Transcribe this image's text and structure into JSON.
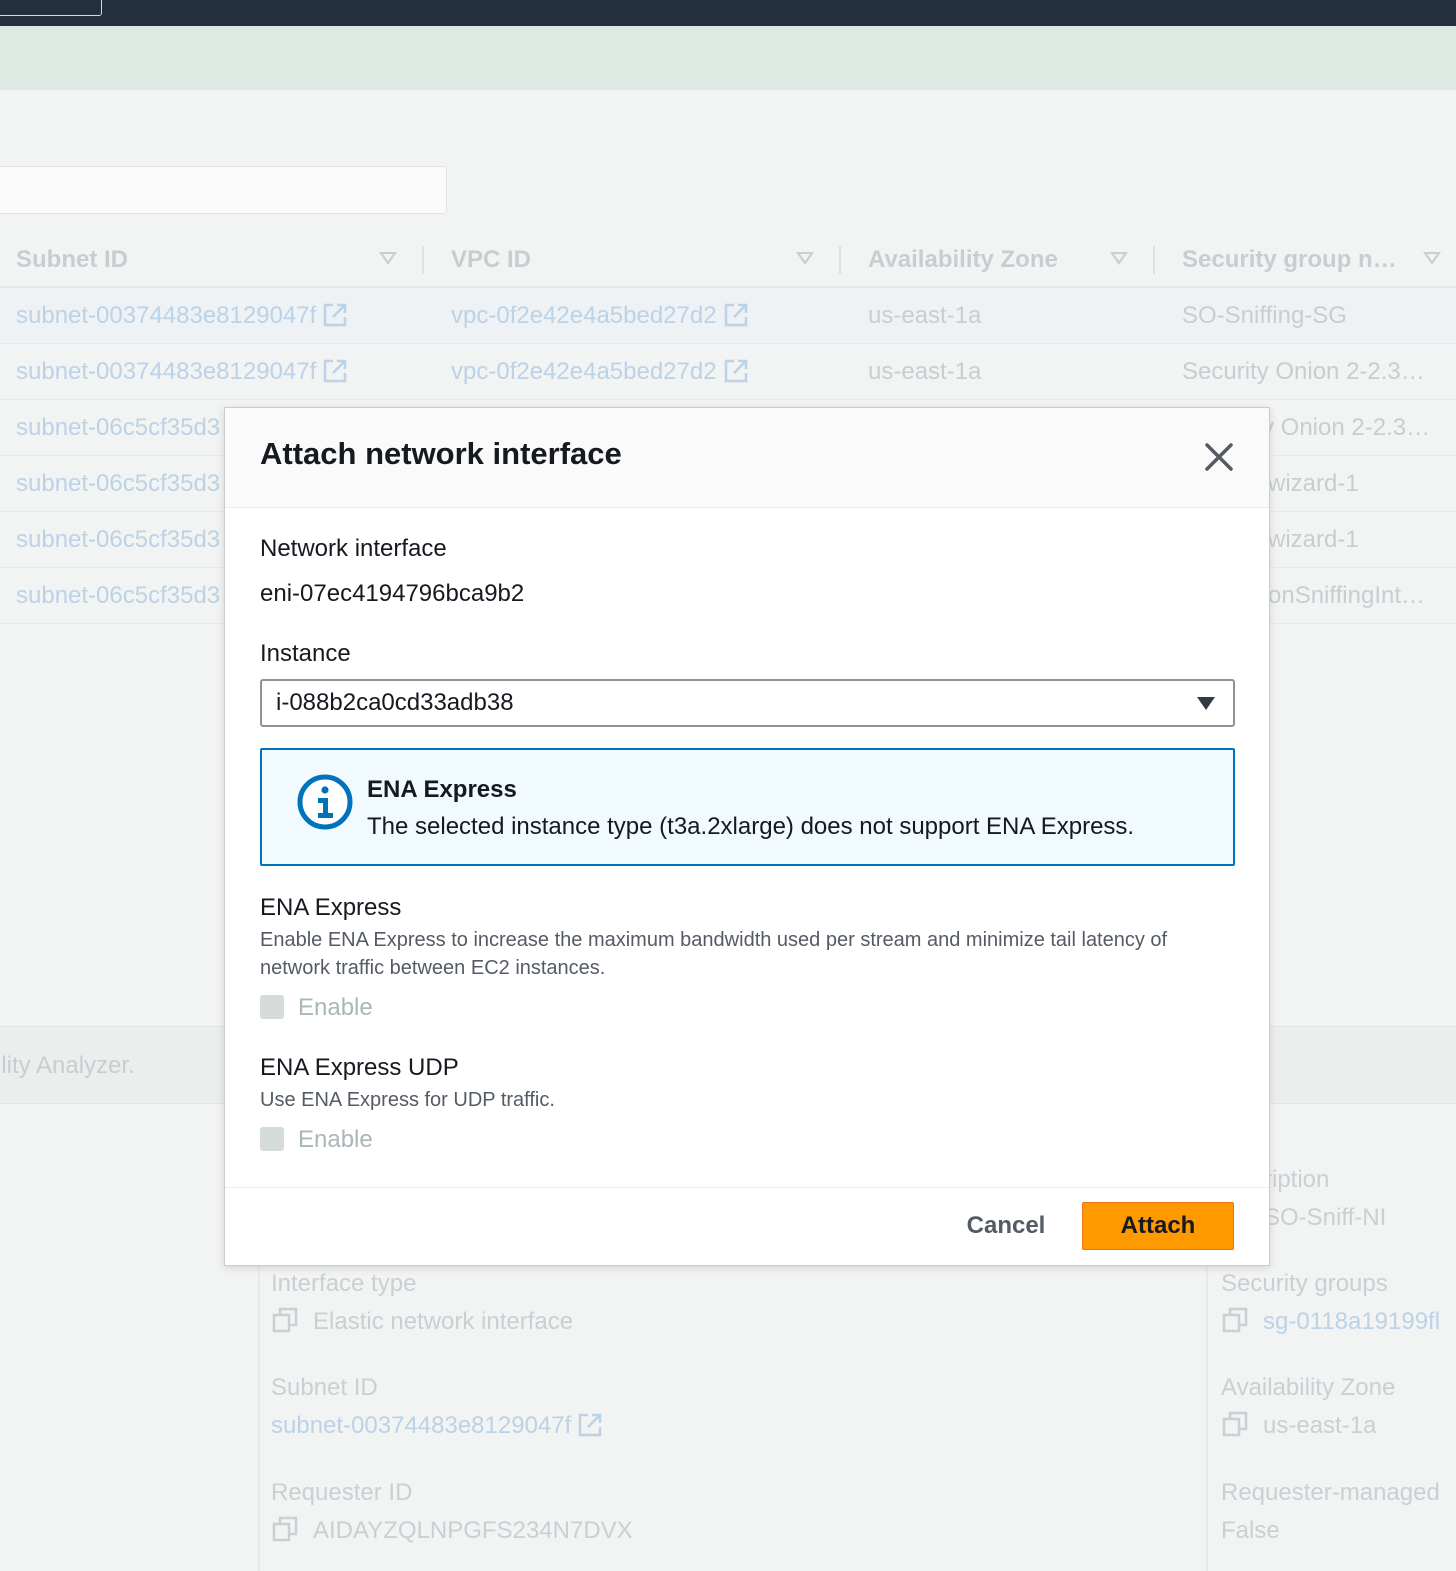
{
  "background": {
    "table": {
      "headers": [
        "Subnet ID",
        "VPC ID",
        "Availability Zone",
        "Security group n…"
      ],
      "rows": [
        {
          "subnet": "subnet-00374483e8129047f",
          "vpc": "vpc-0f2e42e4a5bed27d2",
          "az": "us-east-1a",
          "sg": "SO-Sniffing-SG"
        },
        {
          "subnet": "subnet-00374483e8129047f",
          "vpc": "vpc-0f2e42e4a5bed27d2",
          "az": "us-east-1a",
          "sg": "Security Onion 2-2.3…"
        },
        {
          "subnet": "subnet-06c5cf35d3",
          "sg": "y Onion 2-2.3…"
        },
        {
          "subnet": "subnet-06c5cf35d3",
          "sg": "wizard-1"
        },
        {
          "subnet": "subnet-06c5cf35d3",
          "sg": "wizard-1"
        },
        {
          "subnet": "subnet-06c5cf35d3",
          "sg": "onSniffingInt…"
        }
      ]
    },
    "band_text": "ility Analyzer.",
    "details": {
      "interface_type_label": "Interface type",
      "interface_type_value": "Elastic network interface",
      "subnet_id_label": "Subnet ID",
      "subnet_id_value": "subnet-00374483e8129047f",
      "requester_id_label": "Requester ID",
      "requester_id_value": "AIDAYZQLNPGFS234N7DVX",
      "description_label": "ription",
      "description_value": "SO-Sniff-NI",
      "security_groups_label": "Security groups",
      "security_groups_value": "sg-0118a19199fl",
      "az_label": "Availability Zone",
      "az_value": "us-east-1a",
      "requester_managed_label": "Requester-managed",
      "requester_managed_value": "False"
    }
  },
  "modal": {
    "title": "Attach network interface",
    "network_interface_label": "Network interface",
    "network_interface_value": "eni-07ec4194796bca9b2",
    "instance_label": "Instance",
    "instance_value": "i-088b2ca0cd33adb38",
    "alert": {
      "title": "ENA Express",
      "text": "The selected instance type (t3a.2xlarge) does not support ENA Express."
    },
    "ena_express": {
      "label": "ENA Express",
      "description": "Enable ENA Express to increase the maximum bandwidth used per stream and minimize tail latency of network traffic between EC2 instances.",
      "checkbox_label": "Enable"
    },
    "ena_express_udp": {
      "label": "ENA Express UDP",
      "description": "Use ENA Express for UDP traffic.",
      "checkbox_label": "Enable"
    },
    "cancel_label": "Cancel",
    "attach_label": "Attach"
  },
  "colors": {
    "accent_orange": "#ff9900",
    "info_blue": "#0073bb",
    "topbar": "#232f3e"
  },
  "icons": {
    "close": "close-icon",
    "info": "info-icon",
    "external_link": "external-link-icon",
    "copy": "copy-icon",
    "dropdown": "caret-down-icon"
  }
}
